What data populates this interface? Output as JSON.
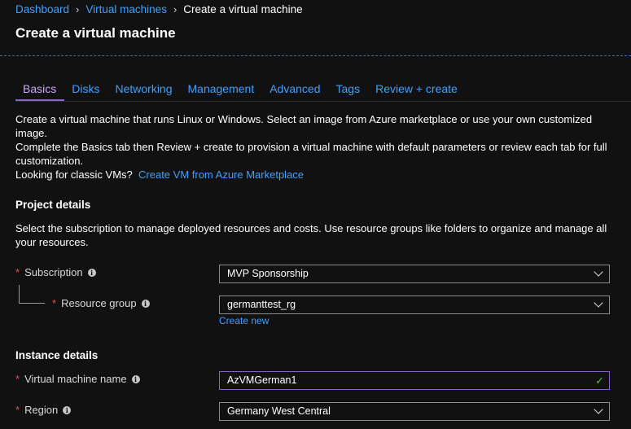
{
  "breadcrumb": {
    "items": [
      "Dashboard",
      "Virtual machines"
    ],
    "current": "Create a virtual machine"
  },
  "page_title": "Create a virtual machine",
  "tabs": [
    {
      "label": "Basics",
      "active": true
    },
    {
      "label": "Disks"
    },
    {
      "label": "Networking"
    },
    {
      "label": "Management"
    },
    {
      "label": "Advanced"
    },
    {
      "label": "Tags"
    },
    {
      "label": "Review + create"
    }
  ],
  "intro": {
    "line1": "Create a virtual machine that runs Linux or Windows. Select an image from Azure marketplace or use your own customized image.",
    "line2": "Complete the Basics tab then Review + create to provision a virtual machine with default parameters or review each tab for full customization.",
    "classic_prefix": "Looking for classic VMs?",
    "classic_link": "Create VM from Azure Marketplace"
  },
  "project_details": {
    "title": "Project details",
    "description": "Select the subscription to manage deployed resources and costs. Use resource groups like folders to organize and manage all your resources.",
    "subscription_label": "Subscription",
    "subscription_value": "MVP Sponsorship",
    "resource_group_label": "Resource group",
    "resource_group_value": "germanttest_rg",
    "create_new": "Create new"
  },
  "instance_details": {
    "title": "Instance details",
    "vm_name_label": "Virtual machine name",
    "vm_name_value": "AzVMGerman1",
    "region_label": "Region",
    "region_value": "Germany West Central"
  },
  "icons": {
    "breadcrumb_separator": "chevron-right-icon",
    "info": "info-icon",
    "dropdown": "chevron-down-icon",
    "valid": "checkmark-icon"
  },
  "colors": {
    "link": "#3ea0ff",
    "active_tab": "#c9a6ff",
    "required": "#e05353",
    "valid": "#5fbf3c"
  }
}
